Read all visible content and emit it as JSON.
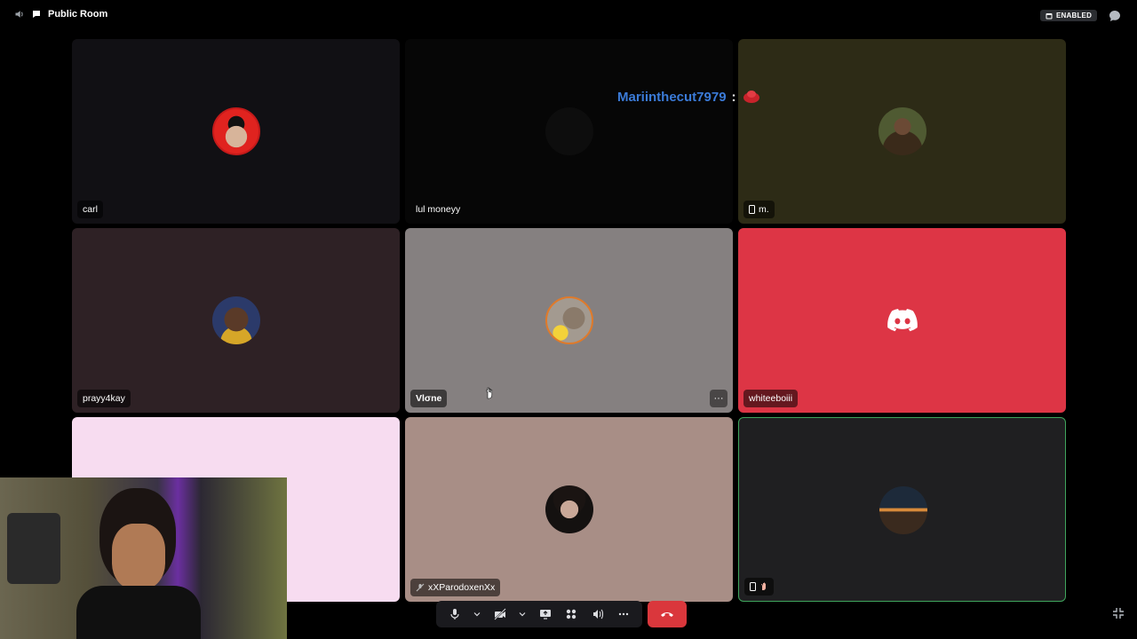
{
  "header": {
    "room_name": "Public Room",
    "badge_text": "ENABLED"
  },
  "chat_overlay": {
    "username": "Mariinthecut7979",
    "separator": ":"
  },
  "tiles": [
    {
      "name": "carl",
      "bg": "#111014",
      "avatar": "red-hat-avatar"
    },
    {
      "name": "lul moneyy",
      "bg": "#060606",
      "avatar": "none"
    },
    {
      "name": "m.",
      "bg": "#2d2b16",
      "avatar": "woman-avatar",
      "mobile": true
    },
    {
      "name": "prayy4kay",
      "bg": "#2e2125",
      "avatar": "man-avatar"
    },
    {
      "name": "Vlσne",
      "bg": "#858080",
      "avatar": "duck-avatar"
    },
    {
      "name": "whiteeboiii",
      "bg": "#dd3545",
      "avatar": "discord-logo"
    },
    {
      "name": "",
      "bg": "#f7dcf0",
      "avatar": "none"
    },
    {
      "name": "xXParodoxenXx",
      "bg": "#a88e86",
      "avatar": "portrait-avatar",
      "muted": true
    },
    {
      "name": "",
      "bg": "#1f1f21",
      "avatar": "sunset-avatar",
      "mobile": true,
      "speaking": true
    }
  ],
  "controls": {
    "items": [
      "microphone-icon",
      "chevron-down-icon",
      "camera-off-icon",
      "chevron-down-icon",
      "screen-share-icon",
      "activities-icon",
      "soundboard-icon",
      "more-icon"
    ],
    "hangup": "hang-up-icon"
  },
  "colors": {
    "accent_blue": "#3b7bd8",
    "discord_red": "#dd3545",
    "speaking_green": "#3fa55c",
    "hangup_red": "#da373c"
  }
}
